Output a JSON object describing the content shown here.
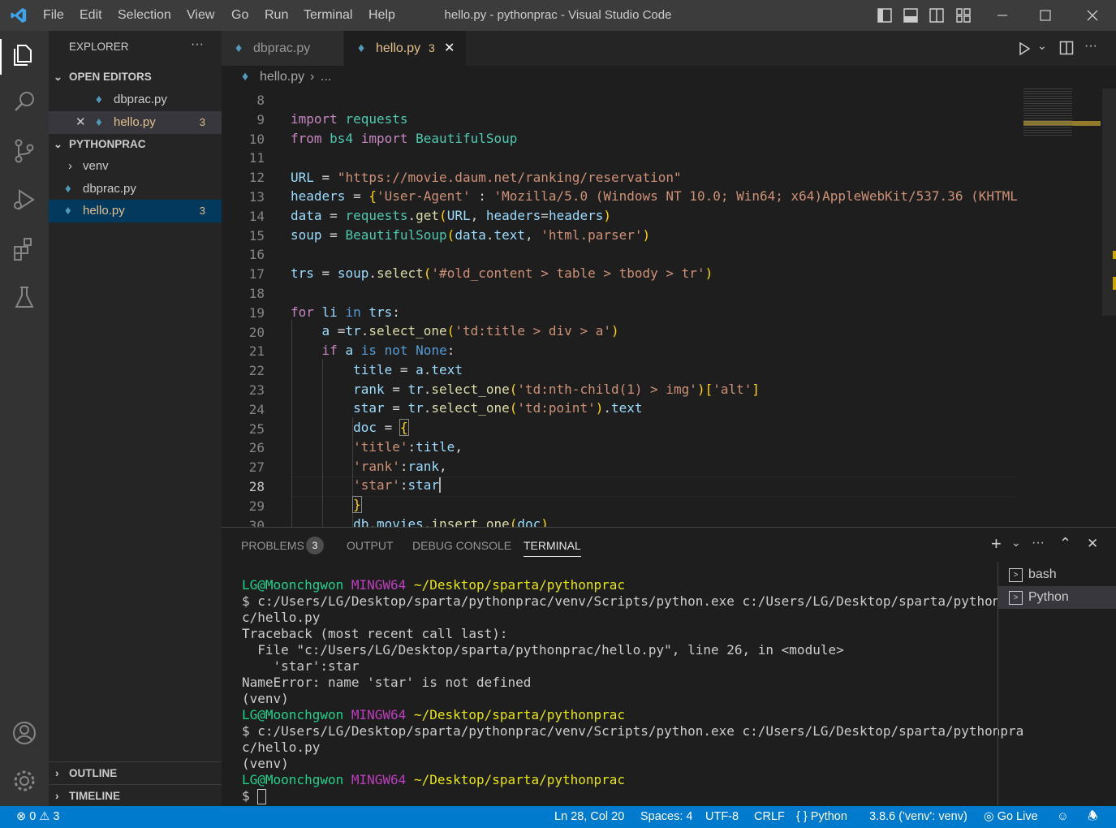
{
  "menu": [
    "File",
    "Edit",
    "Selection",
    "View",
    "Go",
    "Run",
    "Terminal",
    "Help"
  ],
  "window_title": "hello.py - pythonprac - Visual Studio Code",
  "explorer": {
    "title": "EXPLORER",
    "open_editors_label": "OPEN EDITORS",
    "open_editors": [
      {
        "name": "dbprac.py",
        "badge": ""
      },
      {
        "name": "hello.py",
        "badge": "3"
      }
    ],
    "project_label": "PYTHONPRAC",
    "files": [
      {
        "name": "venv",
        "badge": ""
      },
      {
        "name": "dbprac.py",
        "badge": ""
      },
      {
        "name": "hello.py",
        "badge": "3"
      }
    ],
    "outline_label": "OUTLINE",
    "timeline_label": "TIMELINE"
  },
  "tabs": [
    {
      "name": "dbprac.py",
      "badge": ""
    },
    {
      "name": "hello.py",
      "badge": "3"
    }
  ],
  "breadcrumb": {
    "file": "hello.py",
    "rest": "..."
  },
  "line_numbers": [
    "8",
    "9",
    "10",
    "11",
    "12",
    "13",
    "14",
    "15",
    "16",
    "17",
    "18",
    "19",
    "20",
    "21",
    "22",
    "23",
    "24",
    "25",
    "26",
    "27",
    "28",
    "29",
    "30"
  ],
  "panel": {
    "tabs": [
      "PROBLEMS",
      "OUTPUT",
      "DEBUG CONSOLE",
      "TERMINAL"
    ],
    "problems_count": "3",
    "terminals": [
      "bash",
      "Python"
    ],
    "user": "LG@Moonchgwon",
    "host": "MINGW64",
    "path": "~/Desktop/sparta/pythonprac",
    "cmd1a": "$ c:/Users/LG/Desktop/sparta/pythonprac/venv/Scripts/python.exe c:/Users/LG/Desktop/sparta/pythonpra",
    "cmd1b": "c/hello.py",
    "tb1": "Traceback (most recent call last):",
    "tb2": "  File \"c:/Users/LG/Desktop/sparta/pythonprac/hello.py\", line 26, in <module>",
    "tb3": "    'star':star",
    "tb4": "NameError: name 'star' is not defined",
    "venv": "(venv)",
    "prompt": "$ "
  },
  "status": {
    "errors": "0",
    "warnings": "3",
    "position": "Ln 28, Col 20",
    "spaces": "Spaces: 4",
    "encoding": "UTF-8",
    "eol": "CRLF",
    "language": "Python",
    "interpreter": "3.8.6 ('venv': venv)",
    "golive": "Go Live"
  }
}
